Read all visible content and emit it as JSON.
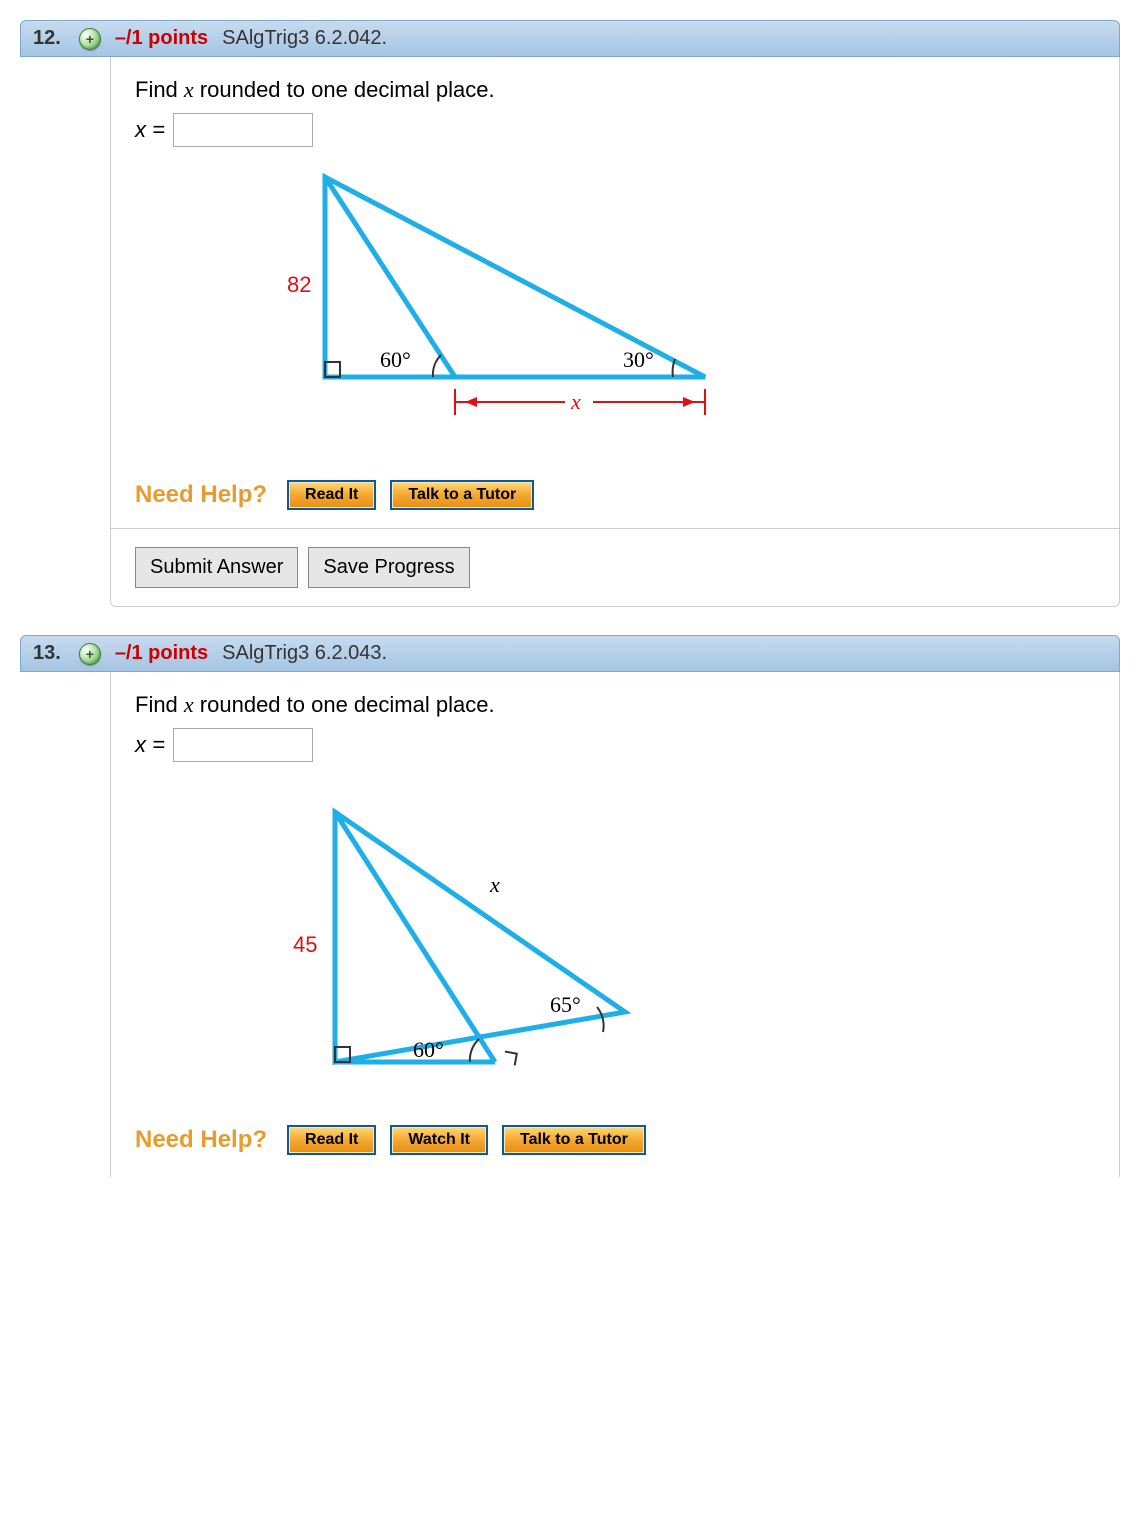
{
  "questions": [
    {
      "number": "12.",
      "points": "–/1 points",
      "ref": "SAlgTrig3 6.2.042.",
      "prompt": "Find x rounded to one decimal place.",
      "xlabel": "x =",
      "diagram": {
        "side_label": "82",
        "angle_left": "60°",
        "angle_right": "30°",
        "span_label": "x"
      },
      "help": {
        "label": "Need Help?",
        "buttons": [
          "Read It",
          "Talk to a Tutor"
        ]
      },
      "submit": {
        "buttons": [
          "Submit Answer",
          "Save Progress"
        ]
      }
    },
    {
      "number": "13.",
      "points": "–/1 points",
      "ref": "SAlgTrig3 6.2.043.",
      "prompt": "Find x rounded to one decimal place.",
      "xlabel": "x =",
      "diagram": {
        "side_label": "45",
        "angle_left": "60°",
        "angle_right": "65°",
        "span_label": "x"
      },
      "help": {
        "label": "Need Help?",
        "buttons": [
          "Read It",
          "Watch It",
          "Talk to a Tutor"
        ]
      }
    }
  ]
}
